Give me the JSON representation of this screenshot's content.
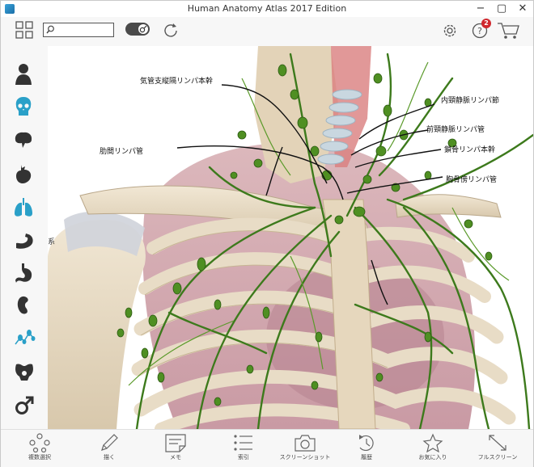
{
  "window": {
    "title": "Human Anatomy Atlas 2017 Edition"
  },
  "toolbar": {
    "search_placeholder": "",
    "help_badge_count": "2"
  },
  "sidebar": {
    "items": [
      {
        "name": "body-systems",
        "icon": "human-figure-icon"
      },
      {
        "name": "skeletal",
        "icon": "skull-icon"
      },
      {
        "name": "nervous",
        "icon": "brain-icon"
      },
      {
        "name": "cardiovascular",
        "icon": "heart-icon"
      },
      {
        "name": "respiratory",
        "icon": "lungs-icon"
      },
      {
        "name": "muscular",
        "icon": "arm-muscle-icon"
      },
      {
        "name": "digestive",
        "icon": "stomach-icon"
      },
      {
        "name": "urinary",
        "icon": "kidney-icon"
      },
      {
        "name": "lymphatic",
        "icon": "lymph-nodes-icon"
      },
      {
        "name": "female-reproductive",
        "icon": "pelvis-icon"
      },
      {
        "name": "male-reproductive",
        "icon": "male-symbol-icon"
      }
    ],
    "partial_label": "系"
  },
  "labels": {
    "tracheobronchial": "気管支縦隔リンパ本幹",
    "intercostal": "肋間リンパ管",
    "internal_jugular": "内頸静脈リンパ節",
    "anterior_jugular": "前頸静脈リンパ管",
    "subclavian": "鎖骨リンパ本幹",
    "parasternal": "胸骨傍リンパ管"
  },
  "bottom_toolbar": {
    "multi_select": "複数選択",
    "draw": "描く",
    "memo": "メモ",
    "index": "索引",
    "screenshot": "スクリーンショット",
    "history": "履歴",
    "favorites": "お気に入り",
    "fullscreen": "フルスクリーン"
  },
  "colors": {
    "accent": "#2aa0c8",
    "lymph_green": "#3d7a1c",
    "bone": "#e8dcc6",
    "badge": "#d0282e"
  }
}
